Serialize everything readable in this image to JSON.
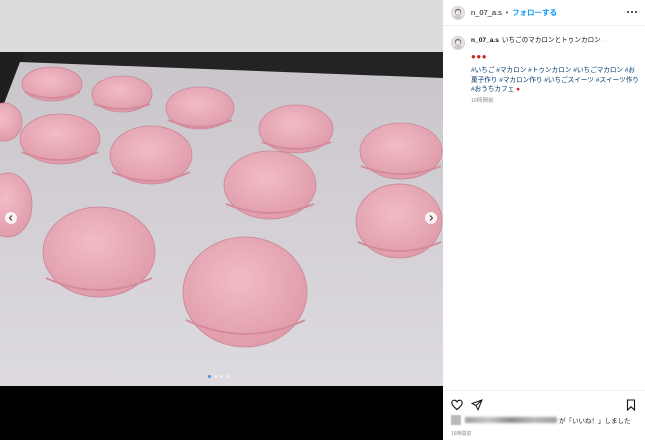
{
  "post": {
    "username": "n_07_a.s",
    "separator": "•",
    "follow_label": "フォローする",
    "caption_username": "n_07_a.s",
    "caption_title": "いちごのマカロンとトゥンカロン",
    "caption_hashtags": "#いちご #マカロン #トゥンカロン #いちごマカロン #お菓子作り #マカロン作り #いちごスイーツ #スイーツ作り #おうちカフェ",
    "caption_time": "16時間前",
    "likes_suffix": "が「いいね！」しました",
    "post_time": "16時間前"
  },
  "carousel": {
    "dot_count": 4,
    "active_index": 0
  },
  "icons": {
    "strawberry": "strawberry-icon",
    "heart": "heart-icon",
    "share": "share-icon",
    "bookmark": "bookmark-icon",
    "more": "more-options-icon"
  },
  "colors": {
    "link": "#0095f6",
    "hashtag": "#00376b",
    "macaron": "#e9a8b6"
  }
}
